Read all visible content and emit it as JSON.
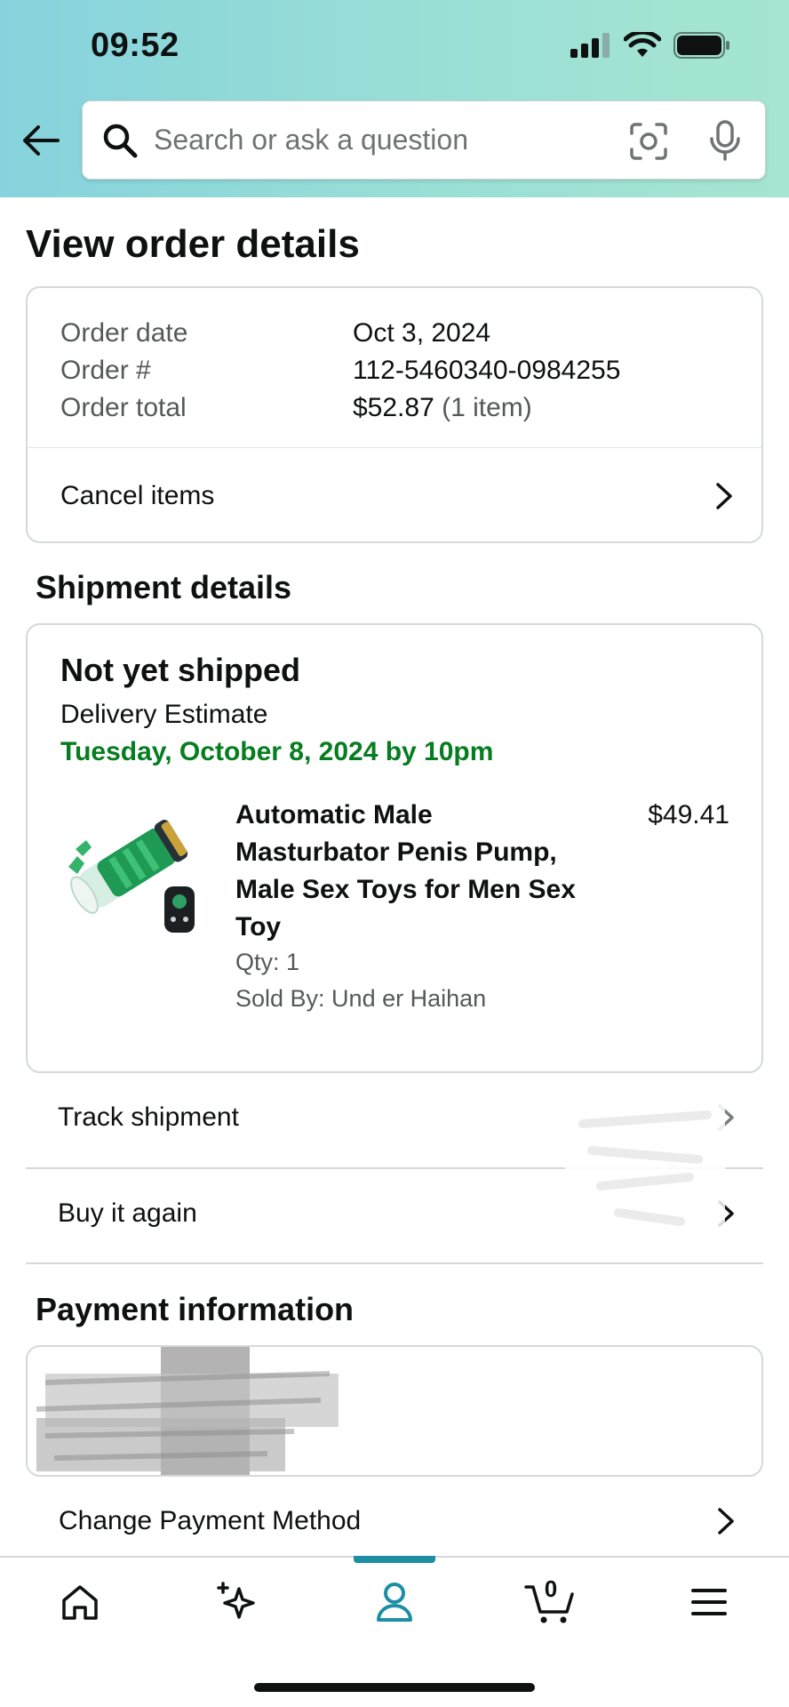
{
  "status": {
    "time": "09:52"
  },
  "header": {
    "search_placeholder": "Search or ask a question"
  },
  "page": {
    "title": "View order details"
  },
  "summary": {
    "rows": [
      {
        "label": "Order date",
        "value": "Oct 3, 2024",
        "extra": ""
      },
      {
        "label": "Order #",
        "value": "112-5460340-0984255",
        "extra": ""
      },
      {
        "label": "Order total",
        "value": "$52.87",
        "extra": " (1 item)"
      }
    ],
    "cancel_label": "Cancel items"
  },
  "shipment": {
    "section_title": "Shipment details",
    "status": "Not yet shipped",
    "delivery_label": "Delivery Estimate",
    "delivery_date": "Tuesday, October 8, 2024 by 10pm",
    "delivery_color": "#067d20",
    "product": {
      "title": "Automatic Male Masturbator Penis Pump, Male Sex Toys for Men Sex Toy",
      "price": "$49.41",
      "qty": "Qty: 1",
      "seller": "Sold By: Und er Haihan"
    },
    "track_label": "Track shipment",
    "buy_again_label": "Buy it again"
  },
  "payment": {
    "section_title": "Payment information",
    "change_label": "Change Payment Method"
  },
  "nav": {
    "items": [
      "home-icon",
      "sparkle-icon",
      "account-icon",
      "cart-icon",
      "menu-icon"
    ],
    "cart_count": "0",
    "active_color": "#1c8fa3"
  }
}
